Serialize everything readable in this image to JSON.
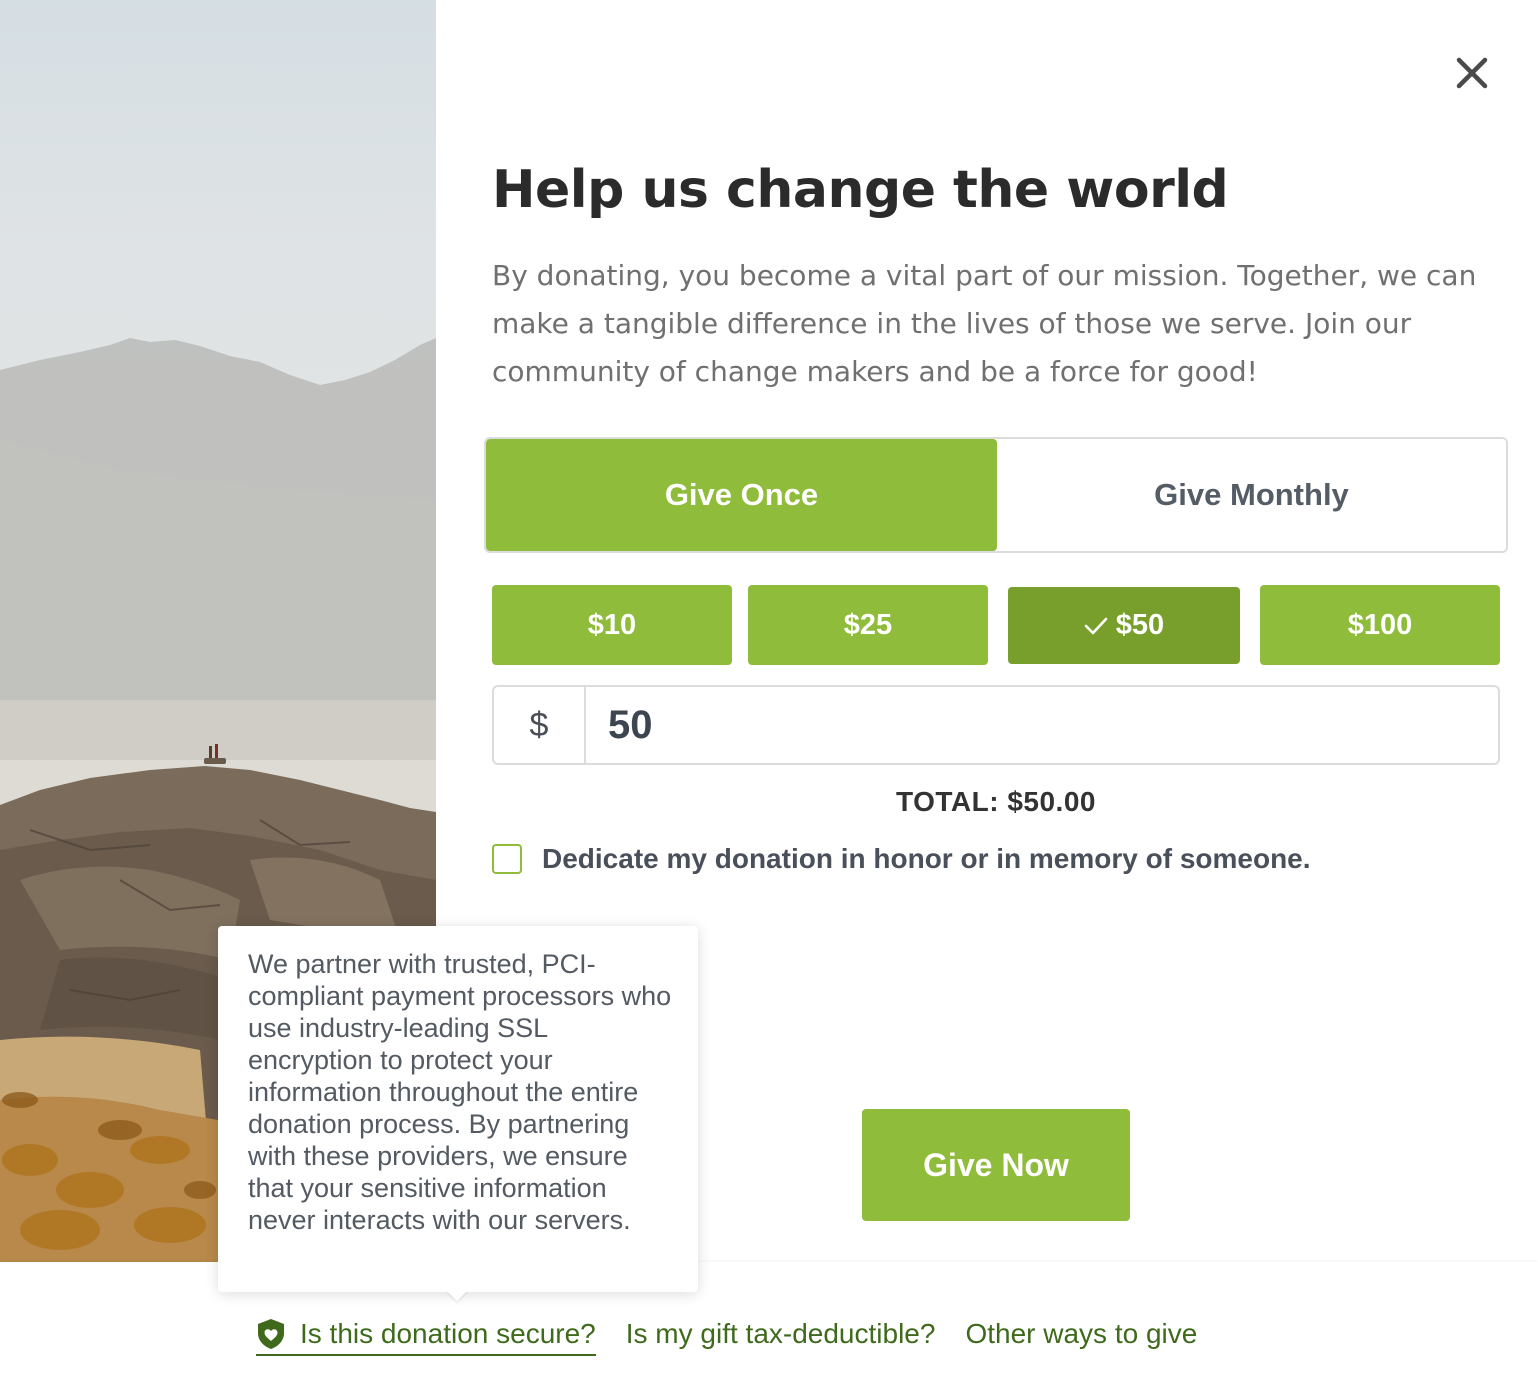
{
  "modal": {
    "title": "Help us change the world",
    "intro": "By donating, you become a vital part of our mission. Together, we can make a tangible difference in the lives of those we serve. Join our community of change makers and be a force for good!",
    "frequency": {
      "once": "Give Once",
      "monthly": "Give Monthly",
      "selected": "once"
    },
    "amounts": [
      {
        "label": "$10"
      },
      {
        "label": "$25"
      },
      {
        "label": "$50",
        "selected": true
      },
      {
        "label": "$100"
      }
    ],
    "currency_symbol": "$",
    "custom_amount": "50",
    "total": "TOTAL: $50.00",
    "dedicate_label": "Dedicate my donation in honor or in memory of someone.",
    "dedicate_checked": false,
    "submit": "Give Now"
  },
  "tooltip": {
    "text": "We partner with trusted, PCI-compliant payment processors who use industry-leading SSL encryption to protect your information throughout the entire donation process. By partnering with these providers, we ensure that your sensitive information never interacts with our servers."
  },
  "footer": {
    "secure": "Is this donation secure?",
    "tax": "Is my gift tax-deductible?",
    "other": "Other ways to give"
  },
  "icons": {
    "close": "close-icon",
    "check": "check-icon",
    "shield": "shield-heart-icon"
  },
  "colors": {
    "accent": "#8fbc3a",
    "accent_selected": "#789f2c",
    "link": "#3f6a1c"
  }
}
